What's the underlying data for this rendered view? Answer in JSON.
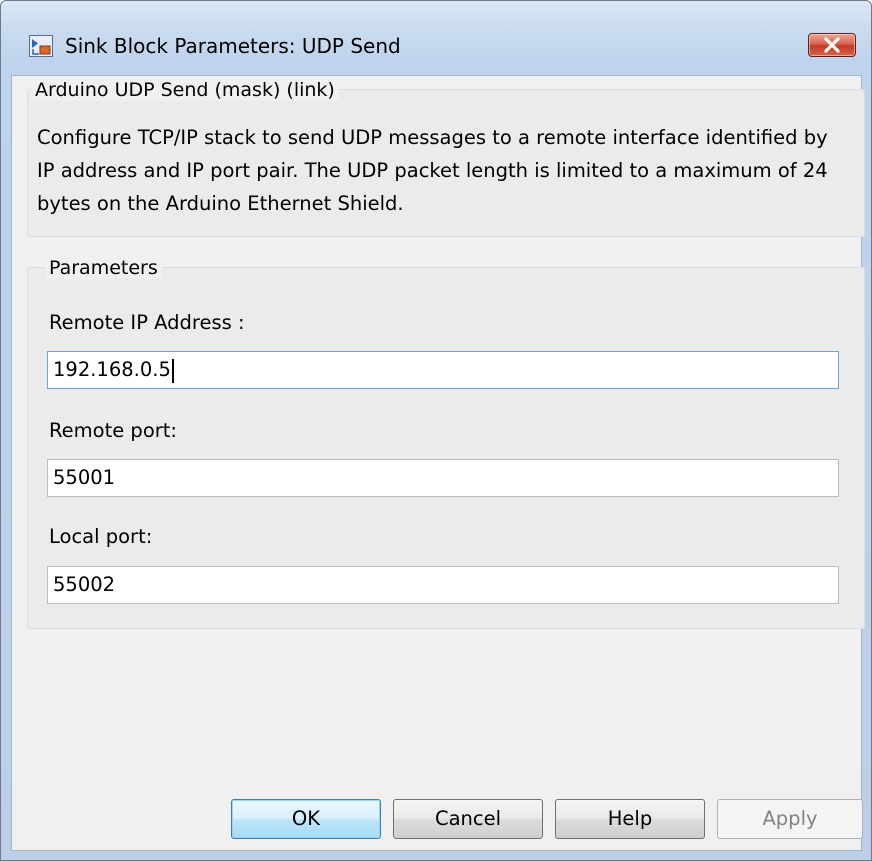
{
  "window": {
    "title": "Sink Block Parameters: UDP Send"
  },
  "mask": {
    "heading": "Arduino UDP Send (mask) (link)",
    "description": "Configure TCP/IP stack to send UDP messages to a remote interface identified by IP address and IP port pair. The UDP packet length is limited to a maximum of 24 bytes on the Arduino Ethernet Shield."
  },
  "parameters": {
    "heading": "Parameters",
    "remote_ip": {
      "label": "Remote IP Address :",
      "value": "192.168.0.5"
    },
    "remote_port": {
      "label": "Remote port:",
      "value": "55001"
    },
    "local_port": {
      "label": "Local port:",
      "value": "55002"
    }
  },
  "buttons": {
    "ok": "OK",
    "cancel": "Cancel",
    "help": "Help",
    "apply": "Apply"
  },
  "icons": {
    "app": "simulink-block-icon",
    "close": "close-icon"
  },
  "colors": {
    "title_bar": "#c9dbef",
    "close_button": "#c33a23",
    "default_button": "#bee6fd"
  }
}
